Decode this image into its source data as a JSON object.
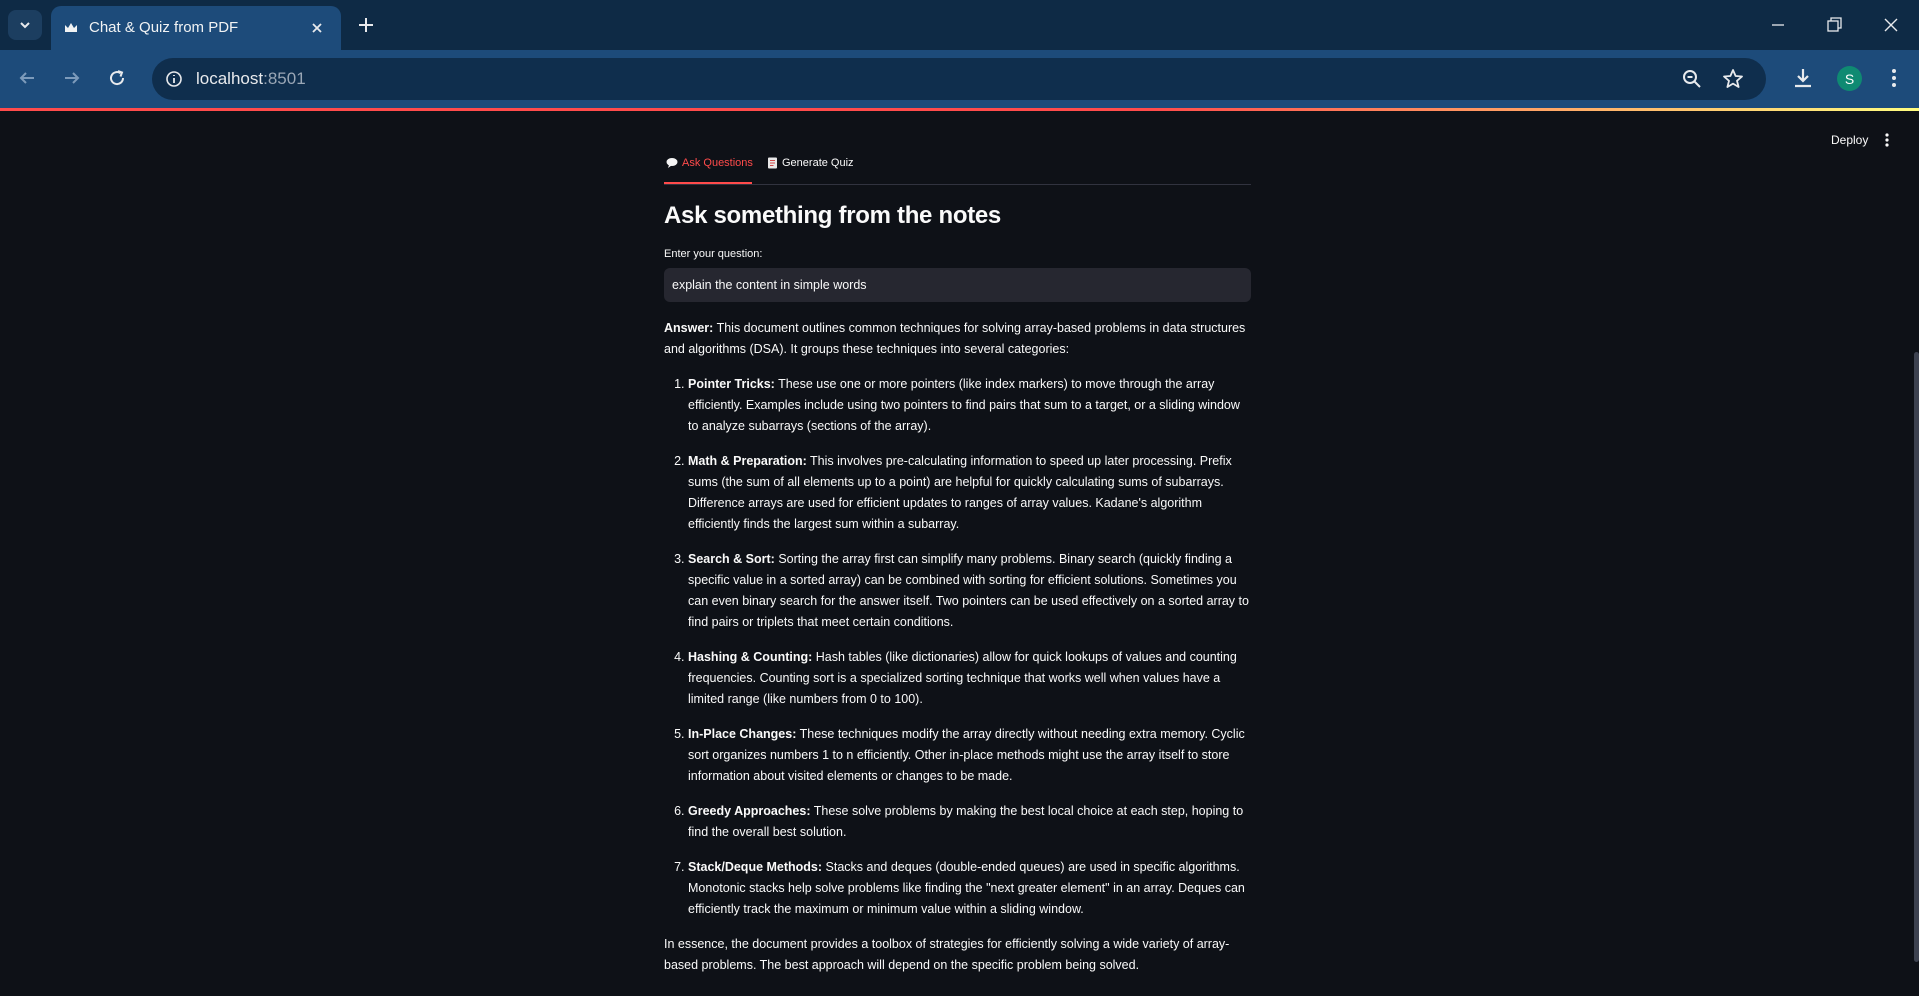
{
  "browser": {
    "tab_title": "Chat & Quiz from PDF",
    "url_host": "localhost",
    "url_port": ":8501",
    "profile_initial": "S"
  },
  "app": {
    "deploy_label": "Deploy",
    "tabs": [
      {
        "icon": "speech-balloon-icon",
        "label": "Ask Questions",
        "active": true
      },
      {
        "icon": "document-icon",
        "label": "Generate Quiz",
        "active": false
      }
    ],
    "title": "Ask something from the notes",
    "input_label": "Enter your question:",
    "input_value": "explain the content in simple words",
    "answer": {
      "lead_bold": "Answer:",
      "lead_text": " This document outlines common techniques for solving array-based problems in data structures and algorithms (DSA). It groups these techniques into several categories:",
      "items": [
        {
          "title": "Pointer Tricks:",
          "text": " These use one or more pointers (like index markers) to move through the array efficiently. Examples include using two pointers to find pairs that sum to a target, or a sliding window to analyze subarrays (sections of the array)."
        },
        {
          "title": "Math & Preparation:",
          "text": " This involves pre-calculating information to speed up later processing. Prefix sums (the sum of all elements up to a point) are helpful for quickly calculating sums of subarrays. Difference arrays are used for efficient updates to ranges of array values. Kadane's algorithm efficiently finds the largest sum within a subarray."
        },
        {
          "title": "Search & Sort:",
          "text": " Sorting the array first can simplify many problems. Binary search (quickly finding a specific value in a sorted array) can be combined with sorting for efficient solutions. Sometimes you can even binary search for the answer itself. Two pointers can be used effectively on a sorted array to find pairs or triplets that meet certain conditions."
        },
        {
          "title": "Hashing & Counting:",
          "text": " Hash tables (like dictionaries) allow for quick lookups of values and counting frequencies. Counting sort is a specialized sorting technique that works well when values have a limited range (like numbers from 0 to 100)."
        },
        {
          "title": "In-Place Changes:",
          "text": " These techniques modify the array directly without needing extra memory. Cyclic sort organizes numbers 1 to n efficiently. Other in-place methods might use the array itself to store information about visited elements or changes to be made."
        },
        {
          "title": "Greedy Approaches:",
          "text": " These solve problems by making the best local choice at each step, hoping to find the overall best solution."
        },
        {
          "title": "Stack/Deque Methods:",
          "text": " Stacks and deques (double-ended queues) are used in specific algorithms. Monotonic stacks help solve problems like finding the \"next greater element\" in an array. Deques can efficiently track the maximum or minimum value within a sliding window."
        }
      ],
      "summary": "In essence, the document provides a toolbox of strategies for efficiently solving a wide variety of array-based problems. The best approach will depend on the specific problem being solved."
    }
  },
  "colors": {
    "accent": "#ff4b4b",
    "background": "#0e1117",
    "input_bg": "#262730",
    "chrome": "#1d4b7a"
  }
}
